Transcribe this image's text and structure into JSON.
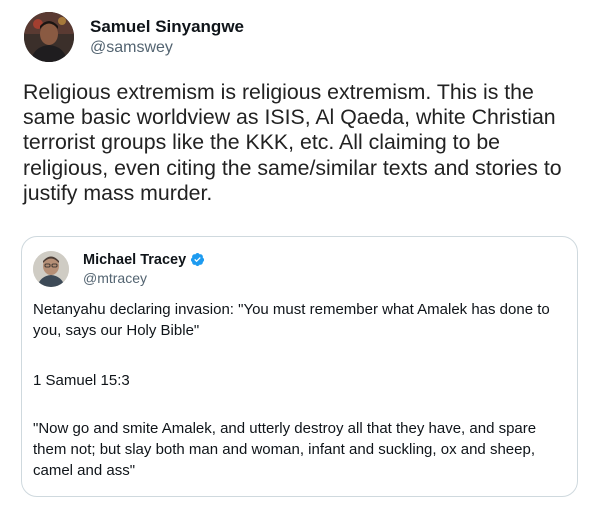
{
  "tweet": {
    "author": {
      "display_name": "Samuel Sinyangwe",
      "handle": "@samswey",
      "avatar_icon": "profile-photo"
    },
    "text": "Religious extremism is religious extremism. This is the same basic worldview as ISIS, Al Qaeda, white Christian terrorist groups like the KKK, etc. All claiming to be religious, even citing the same/similar texts and stories to justify mass murder."
  },
  "quoted_tweet": {
    "author": {
      "display_name": "Michael Tracey",
      "handle": "@mtracey",
      "verified": true,
      "avatar_icon": "profile-photo"
    },
    "paragraphs": [
      "Netanyahu declaring invasion: \"You must remember what Amalek has done to you, says our Holy Bible\"",
      "1 Samuel 15:3",
      "\"Now go and smite Amalek, and utterly destroy all that they have, and spare them not; but slay both man and woman, infant and suckling, ox and sheep, camel and ass\""
    ]
  },
  "colors": {
    "text_primary": "#0f1419",
    "text_secondary": "#536471",
    "border": "#cfd9de",
    "verified_blue": "#1d9bf0"
  }
}
